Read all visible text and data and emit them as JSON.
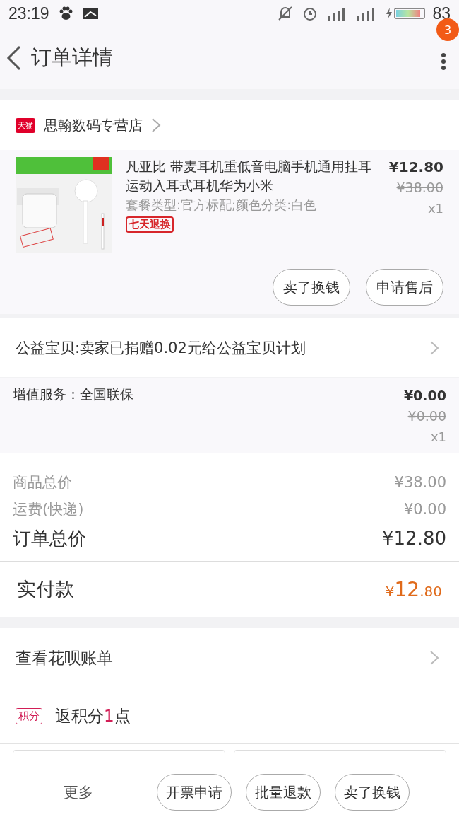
{
  "status_bar": {
    "time": "23:19",
    "battery": "83"
  },
  "header": {
    "title": "订单详情",
    "badge": "3"
  },
  "shop": {
    "tag": "天猫",
    "name": "思翰数码专营店"
  },
  "product": {
    "title": "凡亚比 带麦耳机重低音电脑手机通用挂耳运动入耳式耳机华为小米",
    "spec": "套餐类型:官方标配;颜色分类:白色",
    "tag": "七天退换",
    "price": "¥12.80",
    "original_price": "¥38.00",
    "quantity": "x1",
    "buttons": [
      "卖了换钱",
      "申请售后"
    ]
  },
  "charity": {
    "text": "公益宝贝:卖家已捐赠0.02元给公益宝贝计划"
  },
  "service": {
    "label": "增值服务：全国联保",
    "price": "¥0.00",
    "original_price": "¥0.00",
    "quantity": "x1"
  },
  "totals": [
    {
      "label": "商品总价",
      "value": "¥38.00",
      "kind": "minor"
    },
    {
      "label": "运费(快递)",
      "value": "¥0.00",
      "kind": "minor"
    },
    {
      "label": "订单总价",
      "value": "¥12.80",
      "kind": "major"
    }
  ],
  "paid": {
    "label": "实付款",
    "currency": "¥",
    "integer": "12",
    "decimal": ".80"
  },
  "huabei": {
    "text": "查看花呗账单"
  },
  "points": {
    "tag": "积分",
    "before": "返积分",
    "number": "1",
    "after": "点"
  },
  "bottom_bar": {
    "more": "更多",
    "buttons": [
      "开票申请",
      "批量退款",
      "卖了换钱"
    ]
  }
}
